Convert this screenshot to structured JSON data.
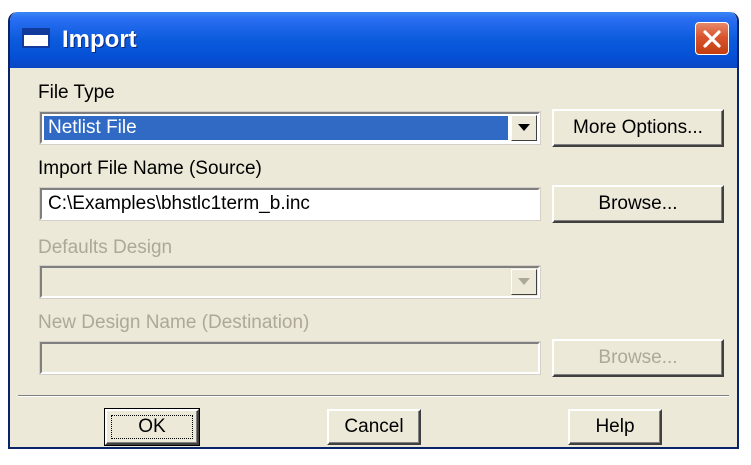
{
  "window": {
    "title": "Import"
  },
  "file_type": {
    "label": "File Type",
    "selected": "Netlist File",
    "more_options_button": "More Options..."
  },
  "import_file": {
    "label": "Import File Name (Source)",
    "value": "C:\\Examples\\bhstlc1term_b.inc",
    "browse_button": "Browse..."
  },
  "defaults_design": {
    "label": "Defaults Design",
    "selected": ""
  },
  "new_design": {
    "label": "New Design Name (Destination)",
    "value": "",
    "browse_button": "Browse..."
  },
  "footer": {
    "ok_button": "OK",
    "cancel_button": "Cancel",
    "help_button": "Help"
  },
  "colors": {
    "titlebar": "#0b5bdc",
    "selection": "#316ac5",
    "dialog_bg": "#ece9d8",
    "disabled_text": "#ada899",
    "close_button": "#d9542e"
  }
}
